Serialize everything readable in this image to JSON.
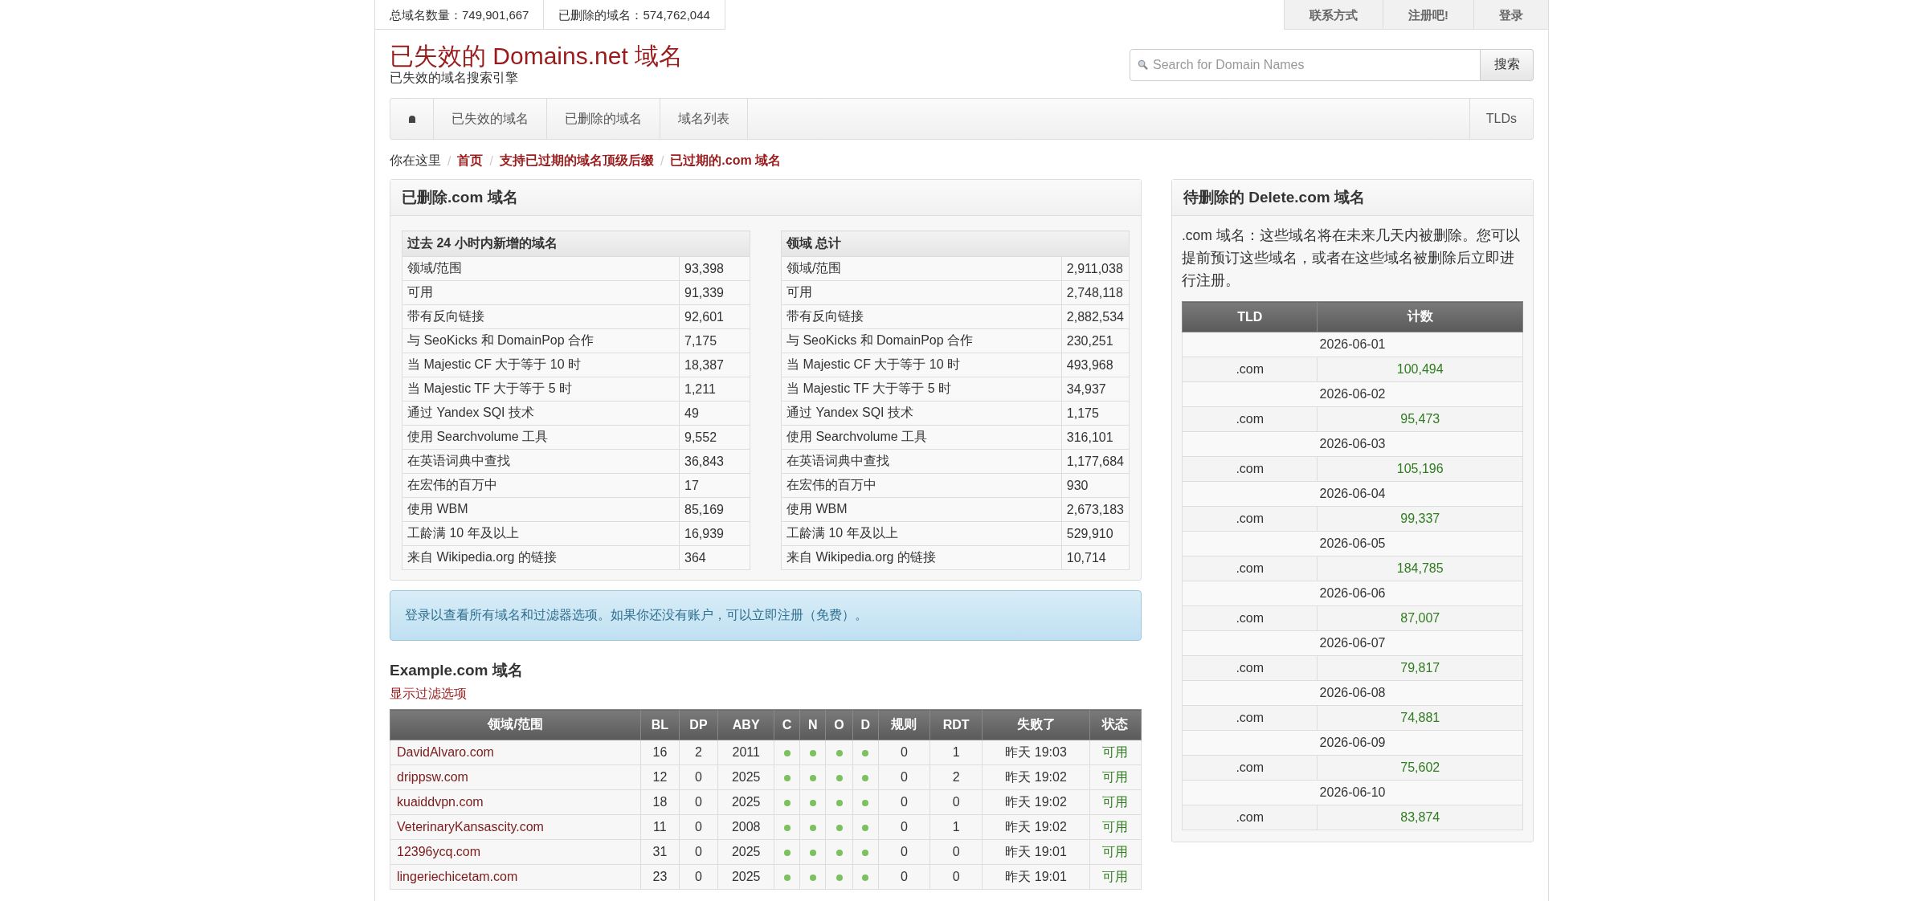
{
  "top_stats": [
    {
      "label": "总域名数量：",
      "value": "749,901,667"
    },
    {
      "label": "已删除的域名：",
      "value": "574,762,044"
    }
  ],
  "top_links": [
    "联系方式",
    "注册吧!",
    "登录"
  ],
  "site": {
    "title": "已失效的 Domains.net 域名",
    "subtitle": "已失效的域名搜索引擎"
  },
  "search": {
    "placeholder": "Search for Domain Names",
    "button": "搜索"
  },
  "nav": {
    "items": [
      "已失效的域名",
      "已删除的域名",
      "域名列表"
    ],
    "right": "TLDs"
  },
  "breadcrumb": {
    "prefix": "你在这里",
    "separator": "/",
    "items": [
      "首页",
      "支持已过期的域名顶级后缀",
      "已过期的.com 域名"
    ]
  },
  "stats_panel": {
    "title": "已删除.com 域名",
    "tables": [
      {
        "heading": "过去 24 小时内新增的域名",
        "rows": [
          [
            "领域/范围",
            "93,398"
          ],
          [
            "可用",
            "91,339"
          ],
          [
            "带有反向链接",
            "92,601"
          ],
          [
            "与 SeoKicks 和 DomainPop 合作",
            "7,175"
          ],
          [
            "当 Majestic CF 大于等于 10 时",
            "18,387"
          ],
          [
            "当 Majestic TF 大于等于 5 时",
            "1,211"
          ],
          [
            "通过 Yandex SQI 技术",
            "49"
          ],
          [
            "使用 Searchvolume 工具",
            "9,552"
          ],
          [
            "在英语词典中查找",
            "36,843"
          ],
          [
            "在宏伟的百万中",
            "17"
          ],
          [
            "使用 WBM",
            "85,169"
          ],
          [
            "工龄满 10 年及以上",
            "16,939"
          ],
          [
            "来自 Wikipedia.org 的链接",
            "364"
          ]
        ]
      },
      {
        "heading": "领域 总计",
        "rows": [
          [
            "领域/范围",
            "2,911,038"
          ],
          [
            "可用",
            "2,748,118"
          ],
          [
            "带有反向链接",
            "2,882,534"
          ],
          [
            "与 SeoKicks 和 DomainPop 合作",
            "230,251"
          ],
          [
            "当 Majestic CF 大于等于 10 时",
            "493,968"
          ],
          [
            "当 Majestic TF 大于等于 5 时",
            "34,937"
          ],
          [
            "通过 Yandex SQI 技术",
            "1,175"
          ],
          [
            "使用 Searchvolume 工具",
            "316,101"
          ],
          [
            "在英语词典中查找",
            "1,177,684"
          ],
          [
            "在宏伟的百万中",
            "930"
          ],
          [
            "使用 WBM",
            "2,673,183"
          ],
          [
            "工龄满 10 年及以上",
            "529,910"
          ],
          [
            "来自 Wikipedia.org 的链接",
            "10,714"
          ]
        ]
      }
    ]
  },
  "alert": "登录以查看所有域名和过滤器选项。如果你还没有账户，可以立即注册（免费）。",
  "domains": {
    "title": "Example.com 域名",
    "filter_link": "显示过滤选项",
    "columns": [
      "领域/范围",
      "BL",
      "DP",
      "ABY",
      "C",
      "N",
      "O",
      "D",
      "规则",
      "RDT",
      "失败了",
      "状态"
    ],
    "rows": [
      {
        "domain": "DavidAlvaro.com",
        "bl": "16",
        "dp": "2",
        "aby": "2011",
        "flags": [
          true,
          true,
          true,
          true
        ],
        "rule": "0",
        "rdt": "1",
        "dropped": "昨天 19:03",
        "status": "可用"
      },
      {
        "domain": "drippsw.com",
        "bl": "12",
        "dp": "0",
        "aby": "2025",
        "flags": [
          true,
          true,
          true,
          true
        ],
        "rule": "0",
        "rdt": "2",
        "dropped": "昨天 19:02",
        "status": "可用"
      },
      {
        "domain": "kuaiddvpn.com",
        "bl": "18",
        "dp": "0",
        "aby": "2025",
        "flags": [
          true,
          true,
          true,
          true
        ],
        "rule": "0",
        "rdt": "0",
        "dropped": "昨天 19:02",
        "status": "可用"
      },
      {
        "domain": "VeterinaryKansascity.com",
        "bl": "11",
        "dp": "0",
        "aby": "2008",
        "flags": [
          true,
          true,
          true,
          true
        ],
        "rule": "0",
        "rdt": "1",
        "dropped": "昨天 19:02",
        "status": "可用"
      },
      {
        "domain": "12396ycq.com",
        "bl": "31",
        "dp": "0",
        "aby": "2025",
        "flags": [
          true,
          true,
          true,
          true
        ],
        "rule": "0",
        "rdt": "0",
        "dropped": "昨天 19:01",
        "status": "可用"
      },
      {
        "domain": "lingeriechicetam.com",
        "bl": "23",
        "dp": "0",
        "aby": "2025",
        "flags": [
          true,
          true,
          true,
          true
        ],
        "rule": "0",
        "rdt": "0",
        "dropped": "昨天 19:01",
        "status": "可用"
      }
    ]
  },
  "pending": {
    "title": "待删除的 Delete.com 域名",
    "description": ".com 域名：这些域名将在未来几天内被删除。您可以提前预订这些域名，或者在这些域名被删除后立即进行注册。",
    "columns": [
      "TLD",
      "计数"
    ],
    "groups": [
      {
        "date": "2026-06-01",
        "tld": ".com",
        "count": "100,494"
      },
      {
        "date": "2026-06-02",
        "tld": ".com",
        "count": "95,473"
      },
      {
        "date": "2026-06-03",
        "tld": ".com",
        "count": "105,196"
      },
      {
        "date": "2026-06-04",
        "tld": ".com",
        "count": "99,337"
      },
      {
        "date": "2026-06-05",
        "tld": ".com",
        "count": "184,785"
      },
      {
        "date": "2026-06-06",
        "tld": ".com",
        "count": "87,007"
      },
      {
        "date": "2026-06-07",
        "tld": ".com",
        "count": "79,817"
      },
      {
        "date": "2026-06-08",
        "tld": ".com",
        "count": "74,881"
      },
      {
        "date": "2026-06-09",
        "tld": ".com",
        "count": "75,602"
      },
      {
        "date": "2026-06-10",
        "tld": ".com",
        "count": "83,874"
      }
    ]
  }
}
